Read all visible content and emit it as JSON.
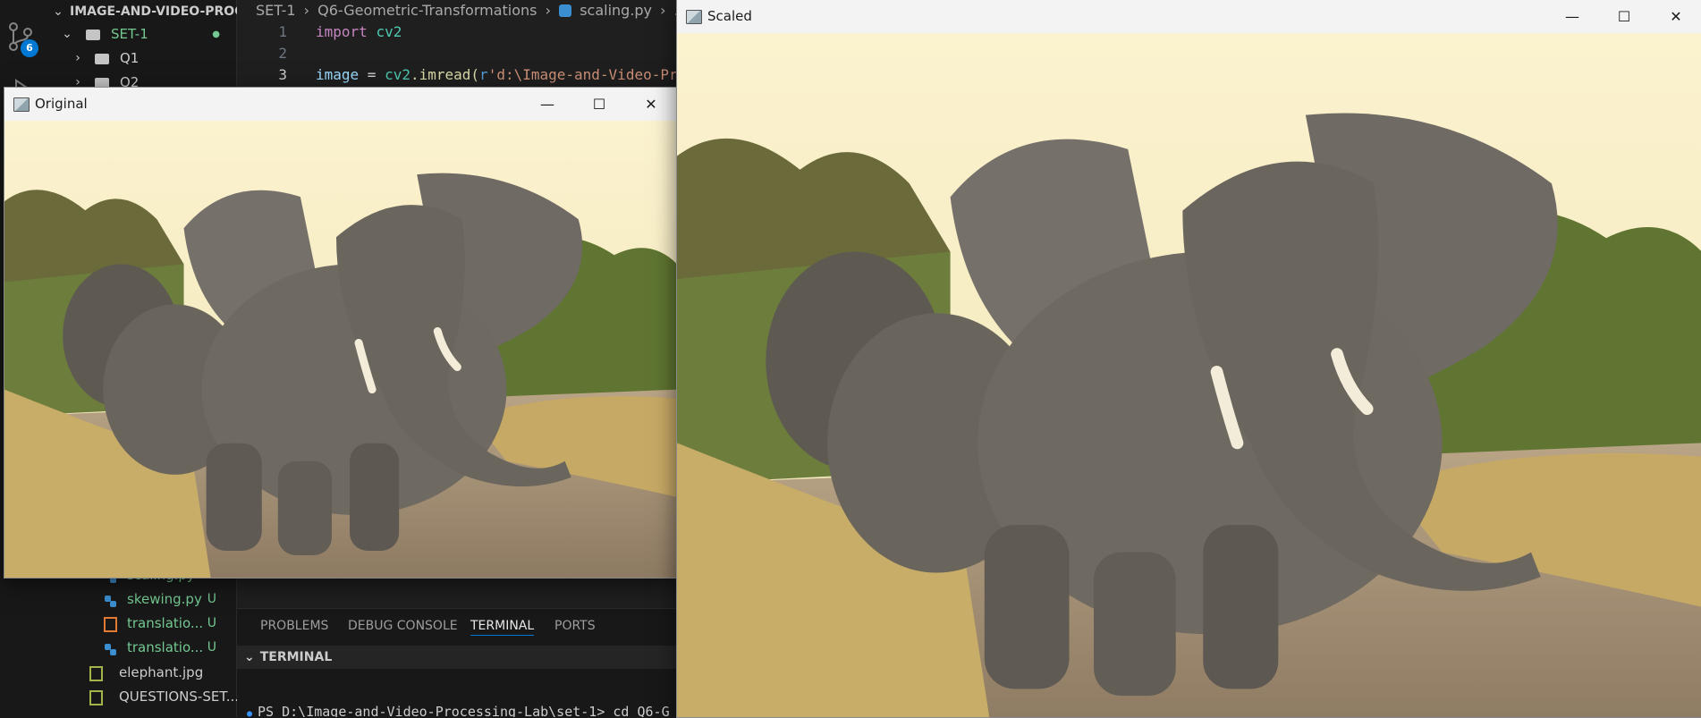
{
  "activity_bar": {
    "scm_badge": "6"
  },
  "explorer": {
    "root_label": "IMAGE-AND-VIDEO-PROC...",
    "set_label": "SET-1",
    "q1_label": "Q1",
    "q2_label": "Q2",
    "files": [
      {
        "name": "scaling.py",
        "status": "U",
        "kind": "python"
      },
      {
        "name": "skewing.py",
        "status": "U",
        "kind": "python"
      },
      {
        "name": "translatio...",
        "status": "U",
        "kind": "image"
      },
      {
        "name": "translatio...",
        "status": "U",
        "kind": "python"
      }
    ],
    "elephant_label": "elephant.jpg",
    "questions_label": "QUESTIONS-SET..."
  },
  "breadcrumb": {
    "set": "SET-1",
    "folder": "Q6-Geometric-Transformations",
    "file": "scaling.py",
    "more": "..."
  },
  "code": {
    "lines": [
      "1",
      "2",
      "3"
    ],
    "kw_import": "import",
    "mod_cv2": "cv2",
    "var_image": "image",
    "eq": " = ",
    "call_obj": "cv2",
    "call_fn": ".imread(",
    "str_prefix": "r",
    "str_val": "'d:\\Image-and-Video-Pr"
  },
  "panel": {
    "tabs": [
      "PROBLEMS",
      "DEBUG CONSOLE",
      "TERMINAL",
      "PORTS"
    ],
    "section": "TERMINAL",
    "prompt": "PS D:\\Image-and-Video-Processing-Lab\\set-1> cd  Q6-G"
  },
  "windows": {
    "original": {
      "title": "Original"
    },
    "scaled": {
      "title": "Scaled"
    }
  },
  "colors": {
    "accent": "#0078d4",
    "untracked": "#73c991",
    "string": "#ce9178",
    "keyword": "#c586c0",
    "variable": "#9cdcfe",
    "type": "#4ec9b0"
  }
}
